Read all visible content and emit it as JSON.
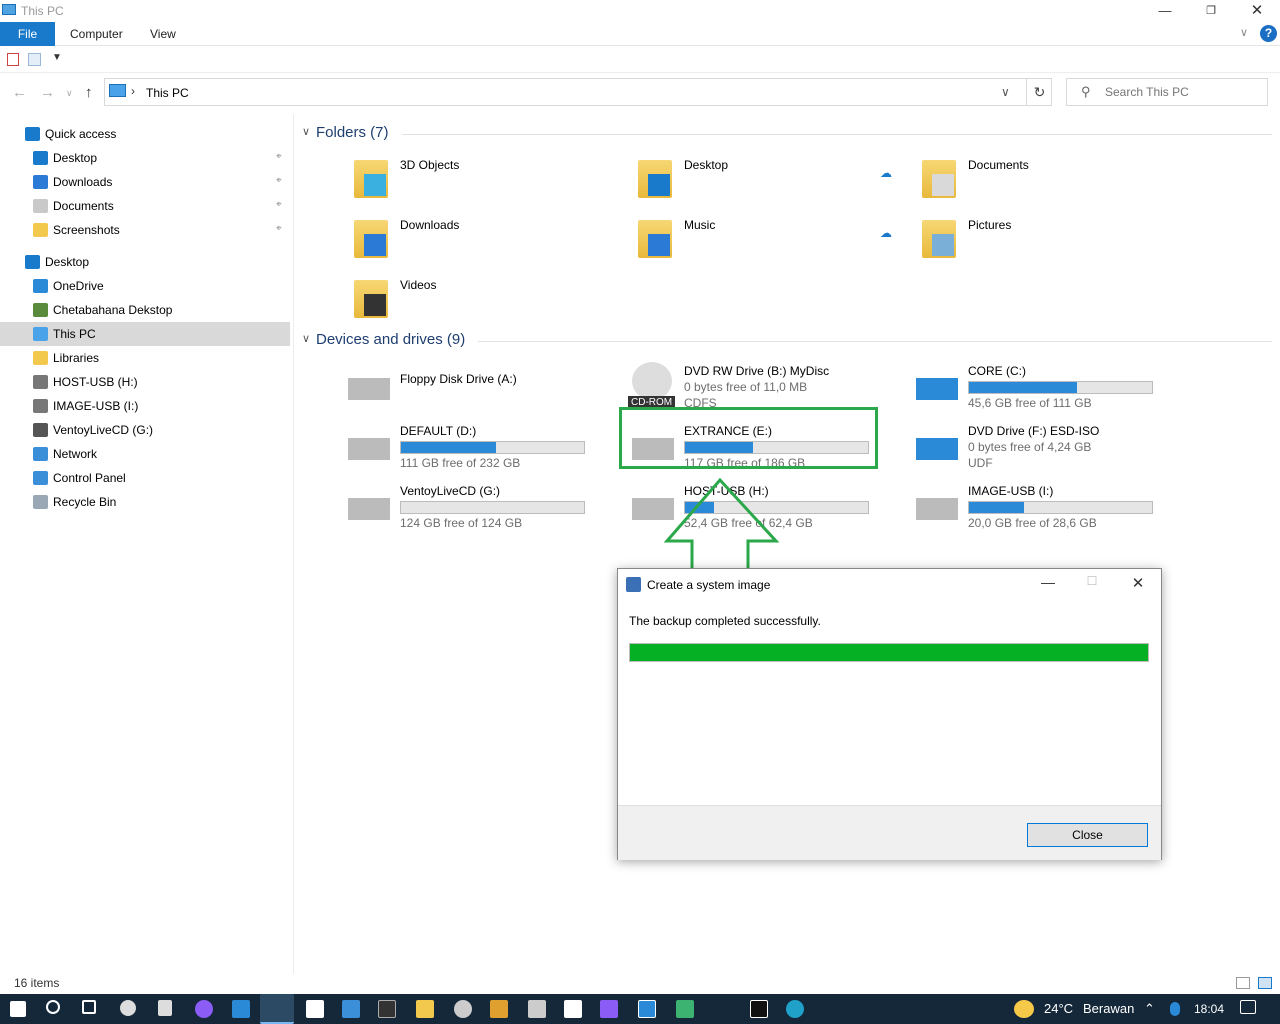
{
  "window": {
    "title": "This PC"
  },
  "ribbon": {
    "file": "File",
    "tabs": [
      "Computer",
      "View"
    ],
    "help": "?"
  },
  "address": {
    "location": "This PC",
    "search_placeholder": "Search This PC"
  },
  "nav": {
    "quick_access": "Quick access",
    "quick_items": [
      {
        "label": "Desktop",
        "icon": "desktop-icon",
        "color": "#1979ca"
      },
      {
        "label": "Downloads",
        "icon": "download-icon",
        "color": "#2b7bd6"
      },
      {
        "label": "Documents",
        "icon": "document-icon",
        "color": "#c9c9c9"
      },
      {
        "label": "Screenshots",
        "icon": "folder-icon",
        "color": "#f2c94c"
      }
    ],
    "desktop": "Desktop",
    "desktop_items": [
      {
        "label": "OneDrive",
        "icon": "cloud-icon",
        "color": "#2a8ad8"
      },
      {
        "label": "Chetabahana Dekstop",
        "icon": "user-icon",
        "color": "#5a8a3c"
      },
      {
        "label": "This PC",
        "icon": "computer-icon",
        "color": "#4aa3e8"
      },
      {
        "label": "Libraries",
        "icon": "library-icon",
        "color": "#f2c94c"
      },
      {
        "label": "HOST-USB (H:)",
        "icon": "drive-icon",
        "color": "#777777"
      },
      {
        "label": "IMAGE-USB (I:)",
        "icon": "drive-icon",
        "color": "#777777"
      },
      {
        "label": "VentoyLiveCD (G:)",
        "icon": "usb-icon",
        "color": "#555555"
      },
      {
        "label": "Network",
        "icon": "network-icon",
        "color": "#3b8fd9"
      },
      {
        "label": "Control Panel",
        "icon": "control-panel-icon",
        "color": "#3b8fd9"
      },
      {
        "label": "Recycle Bin",
        "icon": "recycle-bin-icon",
        "color": "#9aa7b5"
      }
    ]
  },
  "folders": {
    "title": "Folders (7)",
    "items": [
      {
        "label": "3D Objects",
        "icon": "3d-objects-icon",
        "badge_color": "#3ab0e0",
        "cloud": false
      },
      {
        "label": "Desktop",
        "icon": "desktop-folder-icon",
        "badge_color": "#1979ca",
        "cloud": true
      },
      {
        "label": "Documents",
        "icon": "documents-folder-icon",
        "badge_color": "#d9d9d9",
        "cloud": false
      },
      {
        "label": "Downloads",
        "icon": "downloads-folder-icon",
        "badge_color": "#2b7bd6",
        "cloud": false
      },
      {
        "label": "Music",
        "icon": "music-folder-icon",
        "badge_color": "#2b7bd6",
        "cloud": true
      },
      {
        "label": "Pictures",
        "icon": "pictures-folder-icon",
        "badge_color": "#7ab0d8",
        "cloud": false
      },
      {
        "label": "Videos",
        "icon": "videos-folder-icon",
        "badge_color": "#333333",
        "cloud": false
      }
    ]
  },
  "drives": {
    "title": "Devices and drives (9)",
    "items": [
      {
        "name": "Floppy Disk Drive (A:)",
        "icon": "floppy-icon"
      },
      {
        "name": "DVD RW Drive (B:) MyDisc",
        "icon": "cdrom-icon",
        "sub1": "0 bytes free of 11,0 MB",
        "sub2": "CDFS",
        "tag": "CD-ROM"
      },
      {
        "name": "CORE (C:)",
        "icon": "windows-drive-icon",
        "free": "45,6 GB free of 111 GB",
        "used": 0.59
      },
      {
        "name": "DEFAULT (D:)",
        "icon": "drive-icon",
        "free": "111 GB free of 232 GB",
        "used": 0.52
      },
      {
        "name": "EXTRANCE (E:)",
        "icon": "drive-icon",
        "free": "117 GB free of 186 GB",
        "used": 0.37
      },
      {
        "name": "DVD Drive (F:) ESD-ISO",
        "icon": "dvd-install-icon",
        "sub1": "0 bytes free of 4,24 GB",
        "sub2": "UDF"
      },
      {
        "name": "VentoyLiveCD (G:)",
        "icon": "usb-stick-icon",
        "free": "124 GB free of 124 GB",
        "used": 0.0
      },
      {
        "name": "HOST-USB (H:)",
        "icon": "drive-icon",
        "free": "52,4 GB free of 62,4 GB",
        "used": 0.16
      },
      {
        "name": "IMAGE-USB (I:)",
        "icon": "drive-icon",
        "free": "20,0 GB free of 28,6 GB",
        "used": 0.3
      }
    ]
  },
  "dialog": {
    "title": "Create a system image",
    "message": "The backup completed successfully.",
    "progress": 1.0,
    "close": "Close"
  },
  "status": {
    "items": "16 items"
  },
  "taskbar": {
    "temp": "24°C",
    "weather": "Berawan",
    "time": "18:04"
  },
  "colors": {
    "accent": "#1979ca",
    "progress": "#06b025",
    "drive_bar": "#2a8ad8",
    "highlight": "#2aa84a"
  }
}
